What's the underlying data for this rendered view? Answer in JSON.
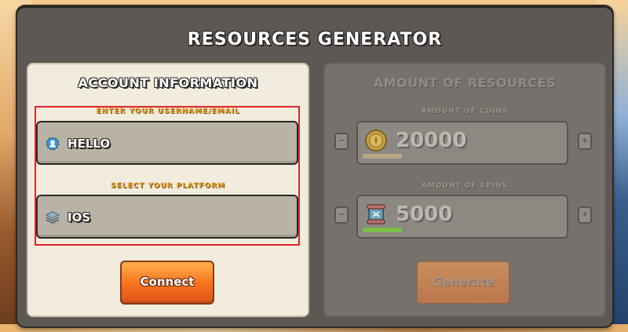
{
  "page": {
    "title": "RESOURCES GENERATOR"
  },
  "account": {
    "title": "ACCOUNT INFORMATION",
    "username_label": "ENTER YOUR USERNAME/EMAIL",
    "username_value": "HELLO",
    "platform_label": "SELECT YOUR PLATFORM",
    "platform_value": "IOS",
    "connect_button": "Connect"
  },
  "resources": {
    "title": "AMOUNT OF RESOURCES",
    "coins_label": "AMOUNT OF COINS",
    "coins_value": "20000",
    "coins_bar_color": "#b7ab86",
    "spins_label": "AMOUNT OF SPINS",
    "spins_value": "5000",
    "spins_bar_color": "#7bbf44",
    "decrease_symbol": "−",
    "increase_symbol": "+",
    "generate_button": "Generate"
  },
  "icons": {
    "user_icon": "user-gear-icon",
    "platform_icon": "layers-icon",
    "coin_icon": "coin-icon",
    "spin_icon": "spin-icon"
  },
  "colors": {
    "panel": "#5e5854",
    "accent_orange": "#f5711c",
    "highlight_red": "#e0232a",
    "label_gold": "#e6a12f"
  }
}
